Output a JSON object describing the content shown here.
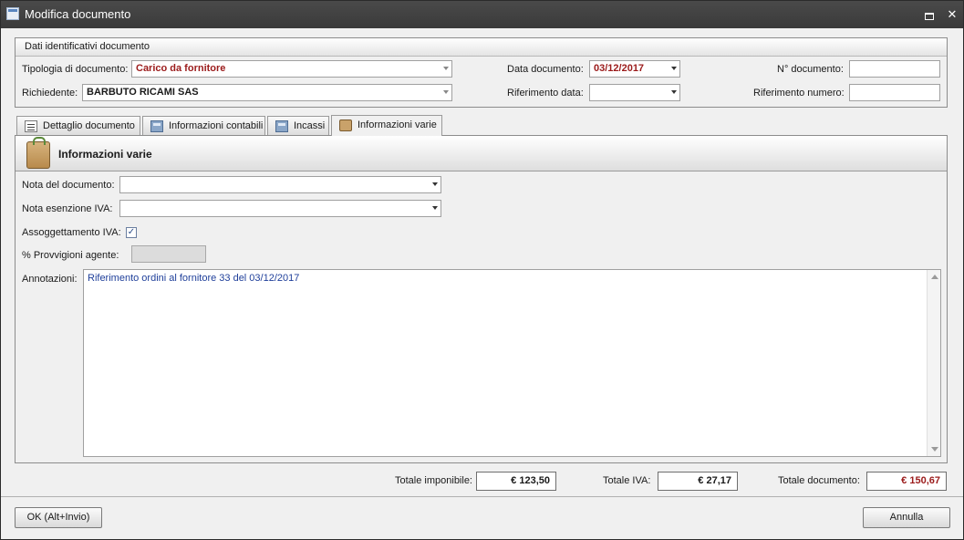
{
  "window": {
    "title": "Modifica documento"
  },
  "group": {
    "title": "Dati identificativi documento",
    "tipologia_label": "Tipologia di documento:",
    "tipologia_value": "Carico da fornitore",
    "richiedente_label": "Richiedente:",
    "richiedente_value": "BARBUTO RICAMI SAS",
    "data_doc_label": "Data documento:",
    "data_doc_value": "03/12/2017",
    "rif_data_label": "Riferimento data:",
    "rif_data_value": "",
    "num_doc_label": "N° documento:",
    "num_doc_value": "",
    "rif_num_label": "Riferimento numero:",
    "rif_num_value": ""
  },
  "tabs": [
    {
      "label": "Dettaglio documento",
      "icon": "list-icon"
    },
    {
      "label": "Informazioni contabili",
      "icon": "calculator-icon"
    },
    {
      "label": "Incassi",
      "icon": "calculator-icon"
    },
    {
      "label": "Informazioni varie",
      "icon": "bag-icon",
      "active": true
    }
  ],
  "panel": {
    "title": "Informazioni varie",
    "nota_doc_label": "Nota del documento:",
    "nota_doc_value": "",
    "nota_iva_label": "Nota esenzione IVA:",
    "nota_iva_value": "",
    "assog_iva_label": "Assoggettamento IVA:",
    "assog_iva_checked": true,
    "provv_label": "% Provvigioni agente:",
    "provv_value": "",
    "annot_label": "Annotazioni:",
    "annot_value": "Riferimento ordini al fornitore  33 del 03/12/2017"
  },
  "totals": {
    "imponibile_label": "Totale imponibile:",
    "imponibile_value": "€ 123,50",
    "iva_label": "Totale IVA:",
    "iva_value": "€ 27,17",
    "documento_label": "Totale documento:",
    "documento_value": "€ 150,67"
  },
  "buttons": {
    "ok_label": "OK (Alt+Invio)",
    "annulla_label": "Annulla"
  },
  "colors": {
    "accent_red": "#9b1b1b",
    "notes_blue": "#1f3f9a"
  }
}
